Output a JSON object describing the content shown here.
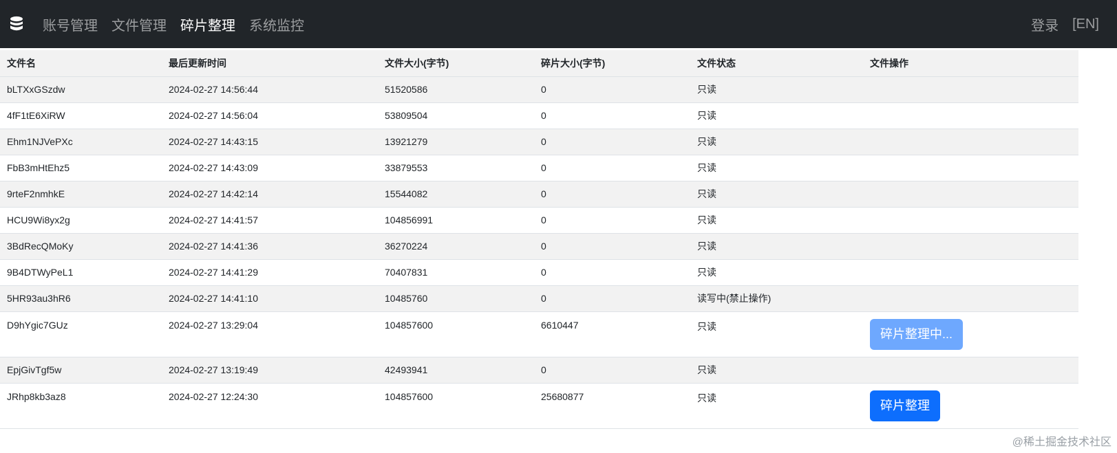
{
  "nav": {
    "brand_icon": "database-icon",
    "links": [
      {
        "label": "账号管理",
        "active": false
      },
      {
        "label": "文件管理",
        "active": false
      },
      {
        "label": "碎片整理",
        "active": true
      },
      {
        "label": "系统监控",
        "active": false
      }
    ],
    "login": "登录",
    "lang": "[EN]"
  },
  "table": {
    "headers": [
      "文件名",
      "最后更新时间",
      "文件大小(字节)",
      "碎片大小(字节)",
      "文件状态",
      "文件操作"
    ],
    "rows": [
      {
        "name": "bLTXxGSzdw",
        "updated": "2024-02-27 14:56:44",
        "size": "51520586",
        "frag": "0",
        "status": "只读",
        "action": ""
      },
      {
        "name": "4fF1tE6XiRW",
        "updated": "2024-02-27 14:56:04",
        "size": "53809504",
        "frag": "0",
        "status": "只读",
        "action": ""
      },
      {
        "name": "Ehm1NJVePXc",
        "updated": "2024-02-27 14:43:15",
        "size": "13921279",
        "frag": "0",
        "status": "只读",
        "action": ""
      },
      {
        "name": "FbB3mHtEhz5",
        "updated": "2024-02-27 14:43:09",
        "size": "33879553",
        "frag": "0",
        "status": "只读",
        "action": ""
      },
      {
        "name": "9rteF2nmhkE",
        "updated": "2024-02-27 14:42:14",
        "size": "15544082",
        "frag": "0",
        "status": "只读",
        "action": ""
      },
      {
        "name": "HCU9Wi8yx2g",
        "updated": "2024-02-27 14:41:57",
        "size": "104856991",
        "frag": "0",
        "status": "只读",
        "action": ""
      },
      {
        "name": "3BdRecQMoKy",
        "updated": "2024-02-27 14:41:36",
        "size": "36270224",
        "frag": "0",
        "status": "只读",
        "action": ""
      },
      {
        "name": "9B4DTWyPeL1",
        "updated": "2024-02-27 14:41:29",
        "size": "70407831",
        "frag": "0",
        "status": "只读",
        "action": ""
      },
      {
        "name": "5HR93au3hR6",
        "updated": "2024-02-27 14:41:10",
        "size": "10485760",
        "frag": "0",
        "status": "读写中(禁止操作)",
        "action": ""
      },
      {
        "name": "D9hYgic7GUz",
        "updated": "2024-02-27 13:29:04",
        "size": "104857600",
        "frag": "6610447",
        "status": "只读",
        "action": "碎片整理中..."
      },
      {
        "name": "EpjGivTgf5w",
        "updated": "2024-02-27 13:19:49",
        "size": "42493941",
        "frag": "0",
        "status": "只读",
        "action": ""
      },
      {
        "name": "JRhp8kb3az8",
        "updated": "2024-02-27 12:24:30",
        "size": "104857600",
        "frag": "25680877",
        "status": "只读",
        "action": "碎片整理"
      }
    ]
  },
  "colors": {
    "navbar_bg": "#212529",
    "primary": "#0d6efd",
    "primary_disabled": "#6ea8fe",
    "stripe": "#f2f2f2"
  },
  "watermark": "@稀土掘金技术社区"
}
